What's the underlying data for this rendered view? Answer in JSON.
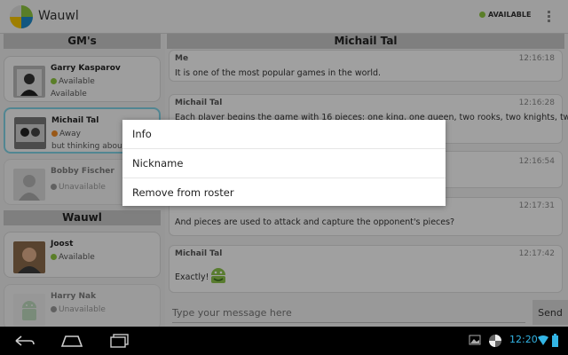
{
  "app": {
    "title": "Wauwl",
    "status_label": "AVAILABLE"
  },
  "roster": {
    "groups": [
      {
        "name": "GM's",
        "contacts": [
          {
            "name": "Garry Kasparov",
            "status": "Available",
            "status_type": "available",
            "message": "Available"
          },
          {
            "name": "Michail Tal",
            "status": "Away",
            "status_type": "away",
            "message": "but thinking about"
          },
          {
            "name": "Bobby Fischer",
            "status": "Unavailable",
            "status_type": "unavailable",
            "message": ""
          }
        ]
      },
      {
        "name": "Wauwl",
        "contacts": [
          {
            "name": "Joost",
            "status": "Available",
            "status_type": "available",
            "message": ""
          },
          {
            "name": "Harry Nak",
            "status": "Unavailable",
            "status_type": "unavailable",
            "message": ""
          }
        ]
      }
    ]
  },
  "chat": {
    "header": "Michail Tal",
    "messages": [
      {
        "sender": "Me",
        "time": "12:16:18",
        "text": "It is one of the most popular games in the world."
      },
      {
        "sender": "Michail Tal",
        "time": "12:16:28",
        "text": "Each player begins the game with 16 pieces: one king, one queen, two rooks, two knights, two"
      },
      {
        "sender": "",
        "time": "12:16:54",
        "text": ""
      },
      {
        "sender": "",
        "time": "12:17:31",
        "text": "And pieces are used to attack and capture the opponent's pieces?"
      },
      {
        "sender": "Michail Tal",
        "time": "12:17:42",
        "text": "Exactly!"
      }
    ],
    "input_placeholder": "Type your message here",
    "send_label": "Send"
  },
  "context_menu": {
    "items": [
      "Info",
      "Nickname",
      "Remove from roster"
    ]
  },
  "system_bar": {
    "clock": "12:20"
  },
  "colors": {
    "available": "#8dc63f",
    "away": "#f08a24",
    "unavailable": "#555555",
    "selected_border": "#7fd2e4",
    "clock": "#33b5e5"
  }
}
